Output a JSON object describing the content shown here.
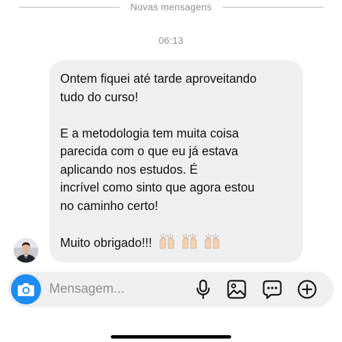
{
  "divider": {
    "label": "Novas mensagens"
  },
  "timestamp": "06:13",
  "message": {
    "lines": [
      "Ontem fiquei até tarde aproveitando",
      "tudo do curso!",
      "",
      "E a metodologia tem muita coisa",
      "parecida com o que eu já estava",
      "aplicando nos estudos. É",
      "incrível como sinto que agora estou",
      "no caminho certo!",
      "",
      "Muito obrigado!!!"
    ],
    "emoji": [
      "🙌🏼",
      "🙌🏼",
      "🙌🏼"
    ]
  },
  "composer": {
    "placeholder": "Mensagem...",
    "icons": [
      "camera-icon",
      "microphone-icon",
      "image-icon",
      "sticker-icon",
      "plus-icon"
    ]
  },
  "colors": {
    "accent": "#1d8cf3",
    "bubble": "#efefef",
    "muted_text": "#8e8e93"
  }
}
